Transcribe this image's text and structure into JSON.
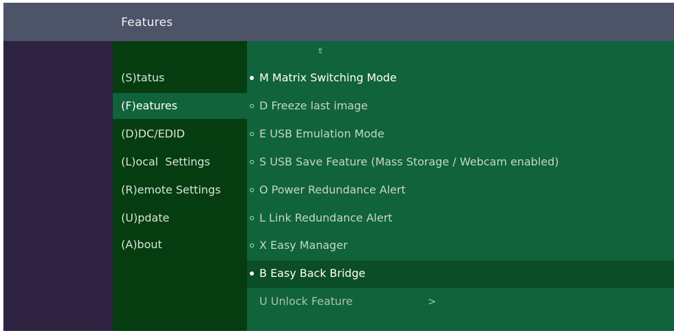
{
  "header": {
    "title": "Features"
  },
  "nav": {
    "items": [
      {
        "label": "(S)tatus"
      },
      {
        "label": "(F)eatures"
      },
      {
        "label": "(D)DC/EDID"
      },
      {
        "label": "(L)ocal  Settings"
      },
      {
        "label": "(R)emote Settings"
      },
      {
        "label": "(U)pdate"
      },
      {
        "label": "(A)bout"
      }
    ],
    "active": "(F)eatures"
  },
  "features": {
    "scroll_up_icon": "up-arrow-icon",
    "items": [
      {
        "label": "M Matrix Switching Mode",
        "enabled": true
      },
      {
        "label": "D Freeze last image",
        "enabled": false
      },
      {
        "label": "E USB Emulation Mode",
        "enabled": false
      },
      {
        "label": "S USB Save Feature (Mass Storage / Webcam enabled)",
        "enabled": false
      },
      {
        "label": "O Power Redundance Alert",
        "enabled": false
      },
      {
        "label": "L Link Redundance Alert",
        "enabled": false
      },
      {
        "label": "X Easy Manager",
        "enabled": false
      },
      {
        "label": "B Easy Back Bridge",
        "enabled": true,
        "selected": true
      },
      {
        "label": "U Unlock Feature",
        "chevron": ">"
      }
    ]
  },
  "colors": {
    "header_bg": "#4d5467",
    "left_pane_bg": "#2d2341",
    "nav_bg": "#063d10",
    "content_bg": "#10633a",
    "selected_row_bg": "#0b4d26"
  }
}
